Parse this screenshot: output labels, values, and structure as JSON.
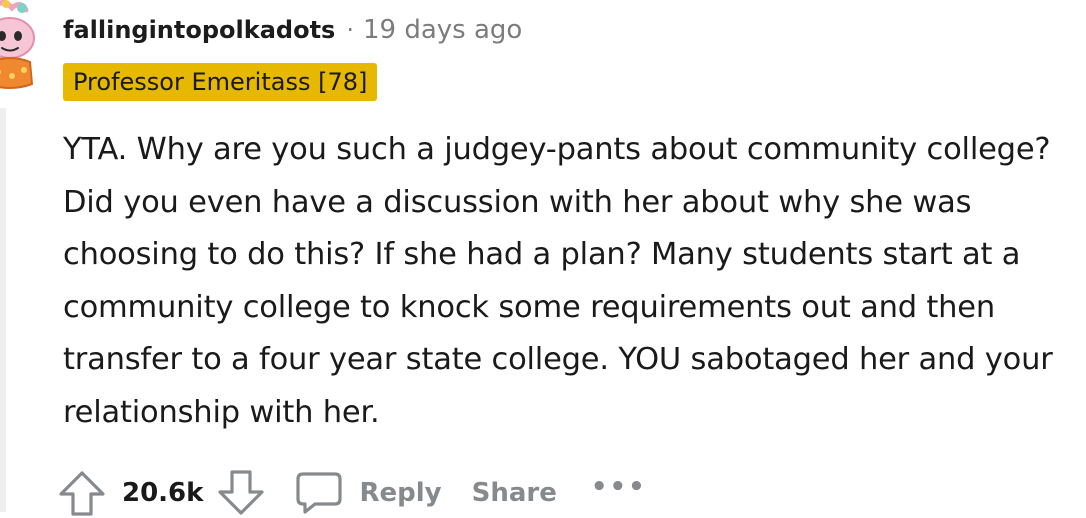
{
  "comment": {
    "username": "fallingintopolkadots",
    "separator": "·",
    "timestamp": "19 days ago",
    "flair": "Professor Emeritass [78]",
    "body": "YTA. Why are you such a judgey-pants about community college? Did you even have a discussion with her about why she was choosing to do this? If she had a plan? Many students start at a community college to knock some requirements out and then transfer to a four year state college. YOU sabotaged her and your relationship with her.",
    "score": "20.6k",
    "reply_label": "Reply",
    "share_label": "Share",
    "more_label": "•••"
  },
  "colors": {
    "flair_background": "#e6b800",
    "muted_text": "#878a8c",
    "thread_line": "#edeff1"
  },
  "icons": {
    "upvote": "upvote-arrow-icon",
    "downvote": "downvote-arrow-icon",
    "reply": "speech-bubble-icon",
    "avatar": "snoo-avatar-icon"
  }
}
